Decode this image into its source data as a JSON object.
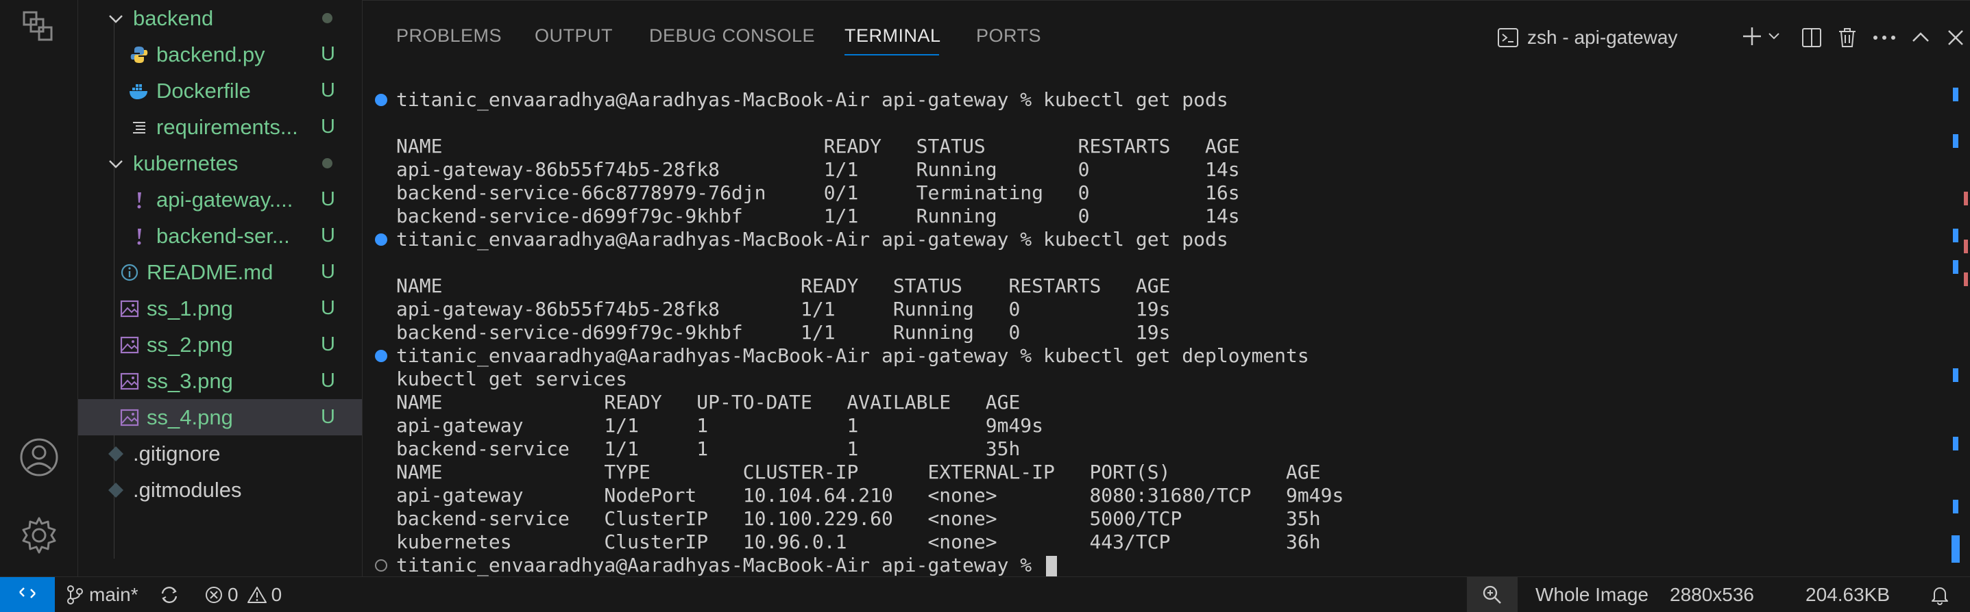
{
  "sidebar": {
    "items": [
      {
        "label": "backend",
        "kind": "folder",
        "status": "dot",
        "color": "green"
      },
      {
        "label": "backend.py",
        "kind": "python",
        "status": "U",
        "color": "green"
      },
      {
        "label": "Dockerfile",
        "kind": "docker",
        "status": "U",
        "color": "green"
      },
      {
        "label": "requirements...",
        "kind": "text",
        "status": "U",
        "color": "green"
      },
      {
        "label": "kubernetes",
        "kind": "folder",
        "status": "dot",
        "color": "green"
      },
      {
        "label": "api-gateway....",
        "kind": "yaml",
        "status": "U",
        "color": "green"
      },
      {
        "label": "backend-ser...",
        "kind": "yaml",
        "status": "U",
        "color": "green"
      },
      {
        "label": "README.md",
        "kind": "info",
        "status": "U",
        "color": "green"
      },
      {
        "label": "ss_1.png",
        "kind": "image",
        "status": "U",
        "color": "green"
      },
      {
        "label": "ss_2.png",
        "kind": "image",
        "status": "U",
        "color": "green"
      },
      {
        "label": "ss_3.png",
        "kind": "image",
        "status": "U",
        "color": "green"
      },
      {
        "label": "ss_4.png",
        "kind": "image",
        "status": "U",
        "color": "green",
        "selected": true
      },
      {
        "label": ".gitignore",
        "kind": "git",
        "status": "",
        "color": "plain"
      },
      {
        "label": ".gitmodules",
        "kind": "git",
        "status": "",
        "color": "plain"
      }
    ]
  },
  "panel": {
    "tabs": [
      {
        "label": "PROBLEMS"
      },
      {
        "label": "OUTPUT"
      },
      {
        "label": "DEBUG CONSOLE"
      },
      {
        "label": "TERMINAL",
        "active": true
      },
      {
        "label": "PORTS"
      }
    ],
    "terminal_name": "zsh - api-gateway"
  },
  "terminal": {
    "lines": [
      {
        "text": "titanic_envaaradhya@Aaradhyas-MacBook-Air api-gateway % kubectl get pods",
        "dot": "blue"
      },
      {
        "text": ""
      },
      {
        "text": "NAME                                 READY   STATUS        RESTARTS   AGE"
      },
      {
        "text": "api-gateway-86b55f74b5-28fk8         1/1     Running       0          14s"
      },
      {
        "text": "backend-service-66c8778979-76djn     0/1     Terminating   0          16s"
      },
      {
        "text": "backend-service-d699f79c-9khbf       1/1     Running       0          14s"
      },
      {
        "text": "titanic_envaaradhya@Aaradhyas-MacBook-Air api-gateway % kubectl get pods",
        "dot": "blue"
      },
      {
        "text": ""
      },
      {
        "text": "NAME                               READY   STATUS    RESTARTS   AGE"
      },
      {
        "text": "api-gateway-86b55f74b5-28fk8       1/1     Running   0          19s"
      },
      {
        "text": "backend-service-d699f79c-9khbf     1/1     Running   0          19s"
      },
      {
        "text": "titanic_envaaradhya@Aaradhyas-MacBook-Air api-gateway % kubectl get deployments",
        "dot": "blue"
      },
      {
        "text": "kubectl get services"
      },
      {
        "text": "NAME              READY   UP-TO-DATE   AVAILABLE   AGE"
      },
      {
        "text": "api-gateway       1/1     1            1           9m49s"
      },
      {
        "text": "backend-service   1/1     1            1           35h"
      },
      {
        "text": "NAME              TYPE        CLUSTER-IP      EXTERNAL-IP   PORT(S)          AGE"
      },
      {
        "text": "api-gateway       NodePort    10.104.64.210   <none>        8080:31680/TCP   9m49s"
      },
      {
        "text": "backend-service   ClusterIP   10.100.229.60   <none>        5000/TCP         35h"
      },
      {
        "text": "kubernetes        ClusterIP   10.96.0.1       <none>        443/TCP          36h"
      },
      {
        "text": "titanic_envaaradhya@Aaradhyas-MacBook-Air api-gateway % ",
        "dot": "hollow",
        "cursor": true
      }
    ]
  },
  "statusbar": {
    "branch": "main*",
    "errors": "0",
    "warnings": "0",
    "image_label": "Whole Image",
    "dimensions": "2880x536",
    "filesize": "204.63KB"
  },
  "colors": {
    "accent": "#0078d4",
    "git_untracked": "#73c991",
    "terminal_dot": "#3794ff"
  }
}
